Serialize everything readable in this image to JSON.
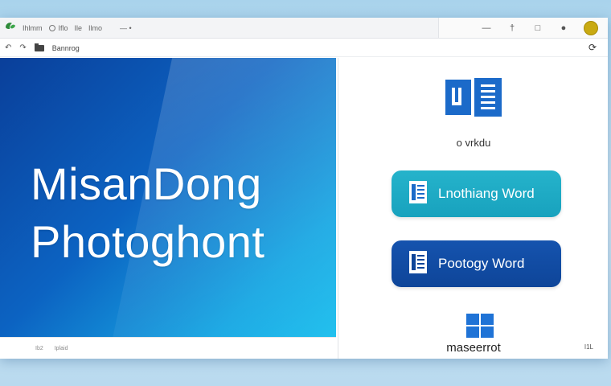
{
  "titlebar": {
    "items": [
      "Ihlmm",
      "Iflo",
      "Ile",
      "Ilmo"
    ],
    "extra": "— •",
    "controls": [
      "—",
      "†",
      "□"
    ]
  },
  "toolbar": {
    "label": "Bannrog"
  },
  "hero": {
    "line1": "MisanDong",
    "line2": "Photoghont"
  },
  "statusbar": {
    "items": [
      "Ib2",
      "Iplaid"
    ]
  },
  "panel": {
    "word_caption": "o vrkdu",
    "button1_label": "Lnothiang Word",
    "button2_label": "Pootogy Word",
    "brand": "maseerrot",
    "corner": "I1L"
  },
  "colors": {
    "hero_dark": "#0a3f9a",
    "hero_light": "#1fc0ee",
    "button_teal": "#1aa6c1",
    "button_blue": "#1050a8",
    "word_blue": "#1b6ac9",
    "windows_blue": "#1f73d6"
  },
  "icons": [
    "leaf-icon",
    "minimize-icon",
    "restore-icon",
    "close-icon",
    "refresh-icon",
    "word-icon",
    "document-icon",
    "windows-logo-icon"
  ]
}
